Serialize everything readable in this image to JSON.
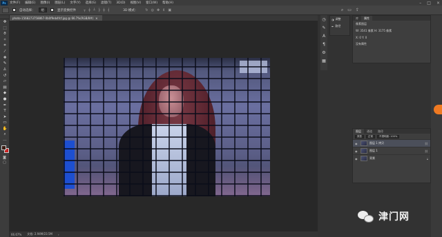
{
  "menubar": {
    "logo": "Ps",
    "items": [
      "文件(F)",
      "编辑(E)",
      "图像(I)",
      "图层(L)",
      "文字(Y)",
      "选择(S)",
      "滤镜(T)",
      "3D(D)",
      "视图(V)",
      "窗口(W)",
      "帮助(H)"
    ]
  },
  "optbar": {
    "auto_select_label": "自动选择：",
    "auto_select_value": "组",
    "show_transform_label": "显示变换控件",
    "mode_3d_label": "3D 模式："
  },
  "document": {
    "tab_title": "photo-1568273758867-0b0f9eb4fcf.jpg @ 66.7%(RGB/8#)",
    "close_glyph": "×"
  },
  "minipanel": {
    "item1": "调整",
    "item2": "路径"
  },
  "properties": {
    "tabs": [
      "库",
      "属性"
    ],
    "title": "像素图层",
    "row_wh": "W: 3541 像素   H: 3175 像素",
    "row_xy": "X: 0            Y: 0",
    "row_info": "没有属性"
  },
  "layers": {
    "tabs": [
      "图层",
      "通道",
      "路径"
    ],
    "kind_label": "类型",
    "blend_mode": "正常",
    "opacity_label": "不透明度: 100%",
    "rows": [
      {
        "name": "图层 1 拷贝",
        "selected": true
      },
      {
        "name": "图层 1",
        "selected": false
      },
      {
        "name": "背景",
        "selected": false
      }
    ]
  },
  "status": {
    "zoom": "66.67%",
    "doc_size": "文档: 2.94M/23.5M"
  },
  "watermark": {
    "text": "津门网"
  },
  "colors": {
    "foreground": "#3b1d14",
    "background": "#c81e1e",
    "accent": "#f07a22"
  }
}
